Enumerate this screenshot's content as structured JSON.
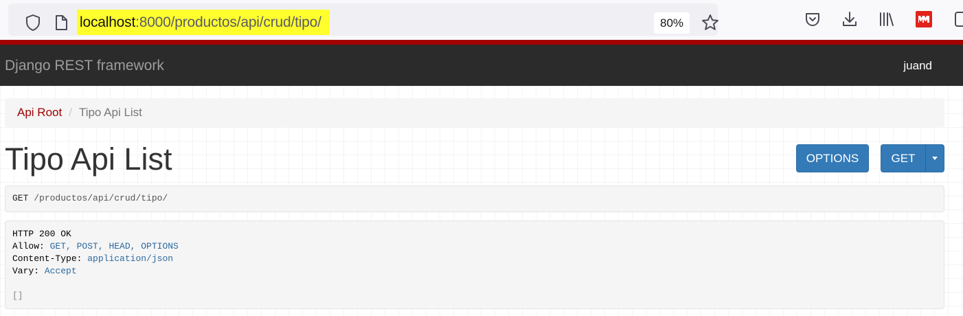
{
  "browser": {
    "url_host": "localhost",
    "url_path": ":8000/productos/api/crud/tipo/",
    "zoom": "80%",
    "icons": [
      "shield-icon",
      "page-icon",
      "star-icon",
      "pocket-icon",
      "download-icon",
      "library-icon",
      "extension-icon",
      "sidebar-icon"
    ],
    "highlight_color": "#ffff2e"
  },
  "navbar": {
    "brand": "Django REST framework",
    "user": "juand",
    "bg_color": "#2b2b2b",
    "accent_color": "#a30000"
  },
  "breadcrumb": {
    "items": [
      {
        "label": "Api Root"
      },
      {
        "label": "Tipo Api List"
      }
    ],
    "separator": "/"
  },
  "page": {
    "title": "Tipo Api List"
  },
  "buttons": {
    "options": "OPTIONS",
    "get": "GET",
    "color": "#337ab7"
  },
  "request": {
    "method": "GET",
    "path": "/productos/api/crud/tipo/"
  },
  "response": {
    "status": "HTTP 200 OK",
    "headers": [
      {
        "key": "Allow:",
        "value": "GET, POST, HEAD, OPTIONS"
      },
      {
        "key": "Content-Type:",
        "value": "application/json"
      },
      {
        "key": "Vary:",
        "value": "Accept"
      }
    ],
    "body": "[]"
  }
}
